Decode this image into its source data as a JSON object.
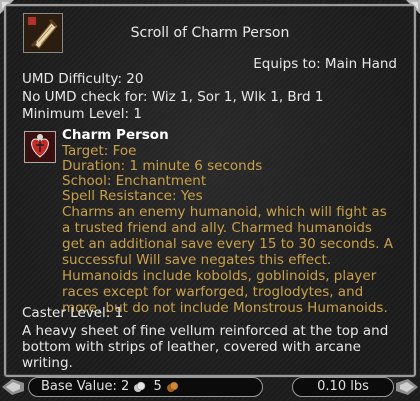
{
  "item": {
    "title": "Scroll of Charm Person",
    "equips_to": "Equips to: Main Hand",
    "umd_difficulty": "UMD Difficulty: 20",
    "no_umd_check": "No UMD check for: Wiz 1, Sor 1, Wlk 1, Brd 1",
    "minimum_level": "Minimum Level: 1",
    "icon": "scroll-icon"
  },
  "spell": {
    "icon": "charm-spell-icon",
    "name": "Charm Person",
    "target": "Target: Foe",
    "duration": "Duration: 1 minute 6 seconds",
    "school": "School: Enchantment",
    "spell_resistance": "Spell Resistance: Yes",
    "description": "Charms an enemy humanoid, which will fight as a trusted friend and ally. Charmed humanoids get an additional save every 15 to 30 seconds. A successful Will save negates this effect. Humanoids include kobolds, goblinoids, player races except for warforged, troglodytes, and more, but do not include Monstrous Humanoids."
  },
  "caster_level": "Caster Level: 1",
  "description": "A heavy sheet of fine vellum reinforced at the top and bottom with strips of leather, covered with arcane writing.",
  "footer": {
    "base_value_label": "Base Value:",
    "silver": "2",
    "copper": "5",
    "weight": "0.10 lbs"
  },
  "colors": {
    "text_primary": "#e8e8e8",
    "spell_text": "#c9a04b",
    "border": "#9a9a9a"
  }
}
